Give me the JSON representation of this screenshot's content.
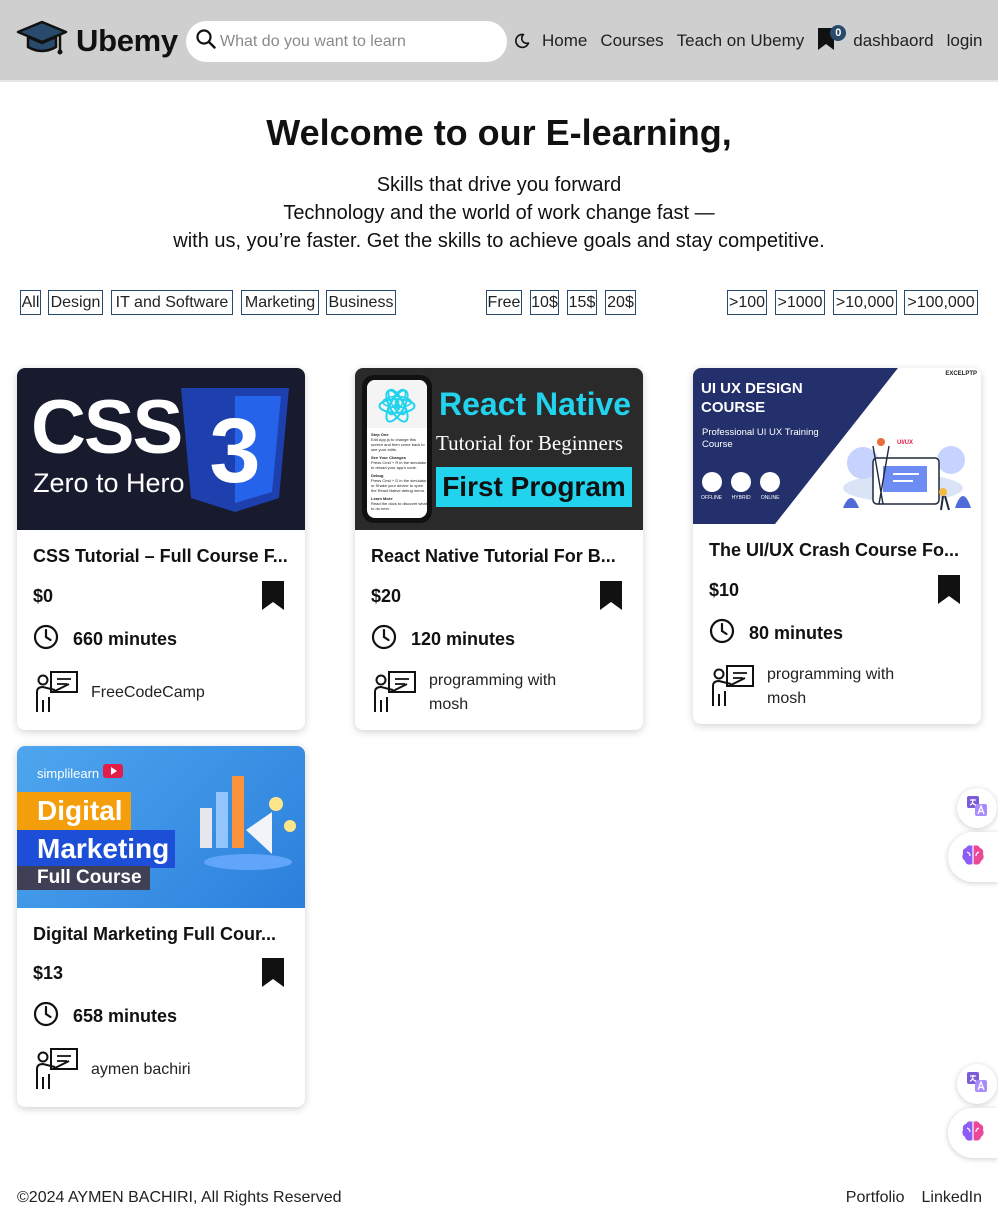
{
  "header": {
    "brand": "Ubemy",
    "search_placeholder": "What do you want to learn",
    "nav": {
      "home": "Home",
      "courses": "Courses",
      "teach": "Teach on Ubemy",
      "cart_count": "0",
      "dashboard": "dashbaord",
      "login": "login"
    }
  },
  "hero": {
    "title": "Welcome to our E-learning,",
    "lines": [
      "Skills that drive you forward",
      "Technology and the world of work change fast —",
      "with us, you’re faster. Get the skills to achieve goals and stay competitive."
    ]
  },
  "filters": {
    "categories": [
      "All",
      "Design",
      "IT and Software",
      "Marketing",
      "Business"
    ],
    "prices": [
      "Free",
      "10$",
      "15$",
      "20$"
    ],
    "students": [
      ">100",
      ">1000",
      ">10,000",
      ">100,000"
    ]
  },
  "courses": [
    {
      "title": "CSS Tutorial – Full Course F...",
      "price": "$0",
      "duration": "660 minutes",
      "teacher": "FreeCodeCamp",
      "thumb": {
        "big": "CSS",
        "sub": "Zero to Hero",
        "badge": "3"
      }
    },
    {
      "title": "React Native Tutorial For B...",
      "price": "$20",
      "duration": "120 minutes",
      "teacher": "programming with mosh",
      "thumb": {
        "line1": "React Native",
        "line2": "Tutorial for Beginners",
        "line3": "First Program",
        "phone_lines": [
          "Step One",
          "Edit App.js to change this screen and then come back to see your edits.",
          "See Your Changes",
          "Press Cmd + R in the simulator to reload your app's code.",
          "Debug",
          "Press Cmd + D in the simulator or Shake your device to open the React Native debug menu.",
          "Learn More",
          "Read the docs to discover what to do next:"
        ]
      }
    },
    {
      "title": "The UI/UX Crash Course Fo...",
      "price": "$10",
      "duration": "80 minutes",
      "teacher": "programming with mosh",
      "thumb": {
        "corner": "EXCELPTP",
        "line1": "UI UX DESIGN",
        "line2": "COURSE",
        "line3": "Professional UI UX Training Course",
        "modes": [
          "OFFLINE",
          "HYBRID",
          "ONLINE"
        ],
        "board": "UI/UX"
      }
    },
    {
      "title": "Digital Marketing Full Cour...",
      "price": "$13",
      "duration": "658 minutes",
      "teacher": "aymen bachiri",
      "thumb": {
        "brand": "simplilearn",
        "line1": "Digital",
        "line2": "Marketing",
        "line3": "Full Course"
      }
    }
  ],
  "footer": {
    "copyright": "©2024 AYMEN BACHIRI, All Rights Reserved",
    "links": [
      "Portfolio",
      "LinkedIn"
    ]
  },
  "colors": {
    "navbar_bg": "#cfcfcf",
    "accent": "#2a4a6b",
    "css_blue": "#2563eb",
    "react_cyan": "#22d3ee"
  },
  "icons": [
    "graduation-cap-icon",
    "search-icon",
    "moon-icon",
    "bookmark-icon",
    "clock-icon",
    "teacher-icon",
    "translate-icon",
    "brain-icon"
  ]
}
